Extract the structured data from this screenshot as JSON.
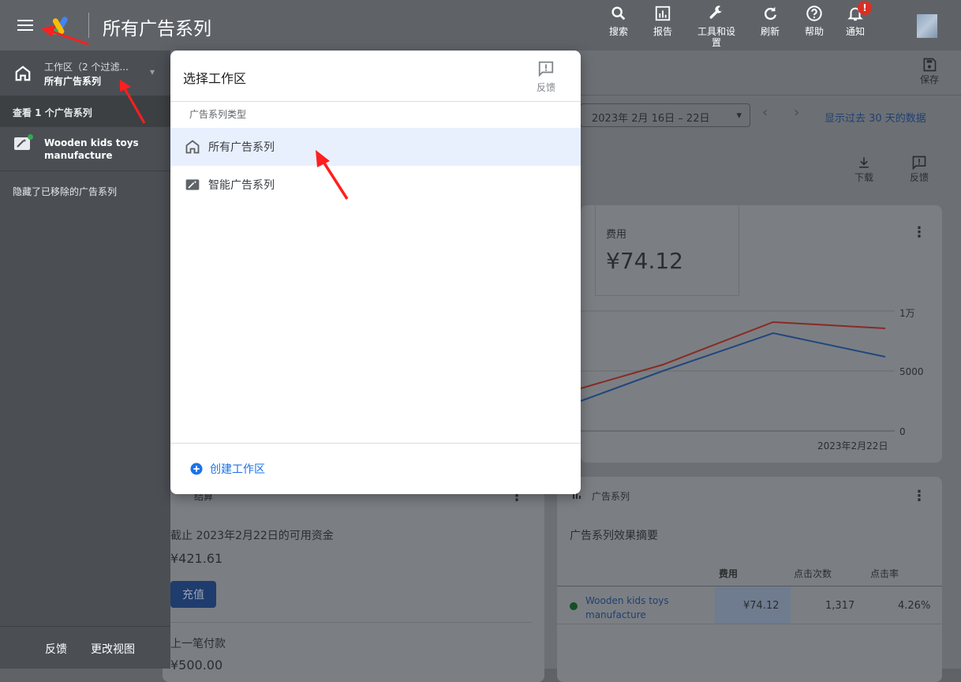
{
  "header": {
    "title": "所有广告系列",
    "tools": [
      {
        "label": "搜索",
        "icon": "search-icon"
      },
      {
        "label": "报告",
        "icon": "bar-chart-icon"
      },
      {
        "label": "工具和设置",
        "icon": "wrench-icon"
      },
      {
        "label": "刷新",
        "icon": "refresh-icon"
      },
      {
        "label": "帮助",
        "icon": "help-icon"
      },
      {
        "label": "通知",
        "icon": "bell-icon"
      }
    ],
    "notification_badge": "!"
  },
  "nav": {
    "workspace_label": "工作区（2 个过滤...",
    "workspace_value": "所有广告系列",
    "heading": "查看 1 个广告系列",
    "campaign": "Wooden kids toys manufacture",
    "hidden_note": "隐藏了已移除的广告系列",
    "footer_feedback": "反馈",
    "footer_change_view": "更改视图"
  },
  "dialog": {
    "title": "选择工作区",
    "feedback": "反馈",
    "section_label": "广告系列类型",
    "items": [
      {
        "label": "所有广告系列",
        "icon": "home-icon",
        "selected": true
      },
      {
        "label": "智能广告系列",
        "icon": "magic-wand-icon",
        "selected": false
      }
    ],
    "create": "创建工作区"
  },
  "main": {
    "save": "保存",
    "date_range": "2023年 2月 16日 – 22日",
    "show_last": "显示过去 30 天的数据",
    "download": "下载",
    "feedback": "反馈",
    "metric_label": "费用",
    "metric_value": "¥74.12",
    "chart_y_ticks": [
      "1万",
      "5000",
      "0"
    ],
    "chart_x_label": "2023年2月22日",
    "budget_title": "结算",
    "funds_label": "截止 2023年2月22日的可用资金",
    "funds_value": "¥421.61",
    "topup": "充值",
    "last_payment_label": "上一笔付款",
    "last_payment_value": "¥500.00",
    "campaign_card_title": "广告系列",
    "summary_title": "广告系列效果摘要",
    "columns": [
      "费用",
      "点击次数",
      "点击率"
    ],
    "row": {
      "name": "Wooden kids toys manufacture",
      "cost": "¥74.12",
      "clicks": "1,317",
      "ctr": "4.26%"
    }
  },
  "colors": {
    "accent": "#1a73e8",
    "selected_row": "#e8f0fe",
    "arrow": "#ff1f1f"
  }
}
